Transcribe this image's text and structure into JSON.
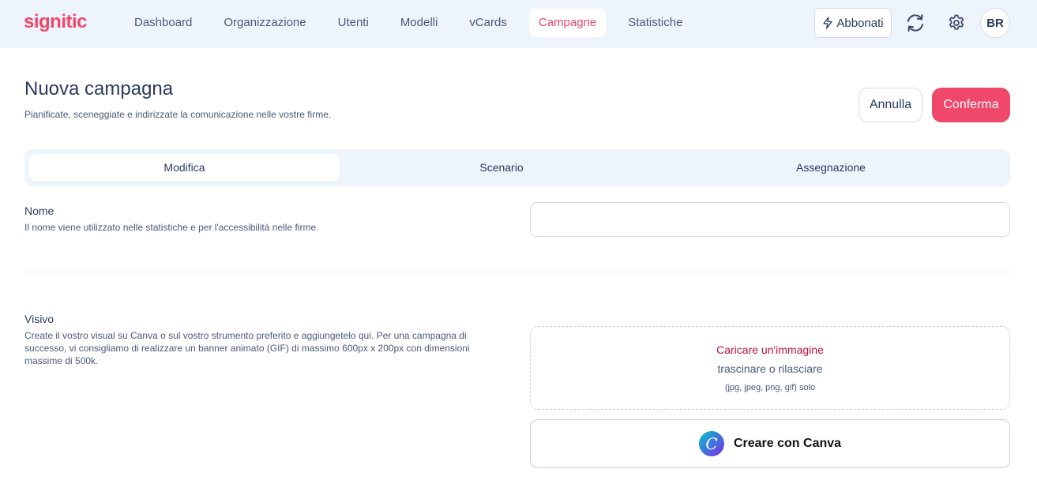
{
  "app": {
    "logo": "signitic"
  },
  "nav": {
    "items": [
      {
        "label": "Dashboard"
      },
      {
        "label": "Organizzazione"
      },
      {
        "label": "Utenti"
      },
      {
        "label": "Modelli"
      },
      {
        "label": "vCards"
      },
      {
        "label": "Campagne",
        "active": true
      },
      {
        "label": "Statistiche"
      }
    ],
    "subscribe_label": "Abbonati",
    "subscribe_icon": "bolt-icon",
    "sync_icon": "refresh-icon",
    "settings_icon": "gear-icon",
    "avatar_initials": "BR"
  },
  "header": {
    "title": "Nuova campagna",
    "subtitle": "Pianificate, sceneggiate e indirizzate la comunicazione nelle vostre firme.",
    "cancel_label": "Annulla",
    "confirm_label": "Conferma"
  },
  "tabs": [
    {
      "label": "Modifica",
      "active": true
    },
    {
      "label": "Scenario"
    },
    {
      "label": "Assegnazione"
    }
  ],
  "name_field": {
    "label": "Nome",
    "help": "Il nome viene utilizzato nelle statistiche e per l'accessibilità nelle firme.",
    "value": "",
    "placeholder": ""
  },
  "visual_field": {
    "label": "Visivo",
    "help": "Create il vostro visual su Canva o sul vostro strumento preferito e aggiungetelo qui. Per una campagna di successo, vi consigliamo di realizzare un banner animato (GIF) di massimo 600px x 200px con dimensioni massime di 500k.",
    "upload_label": "Caricare un'immagine",
    "drag_label": "trascinare o rilasciare",
    "formats_label": "(jpg, jpeg, png, gif) solo",
    "canva_label": "Creare con Canva",
    "canva_icon": "canva-logo-icon"
  },
  "colors": {
    "brand": "#f0486a",
    "upload_link": "#c0123c",
    "nav_bg": "#eef4fc",
    "text": "#2b3a5c"
  }
}
